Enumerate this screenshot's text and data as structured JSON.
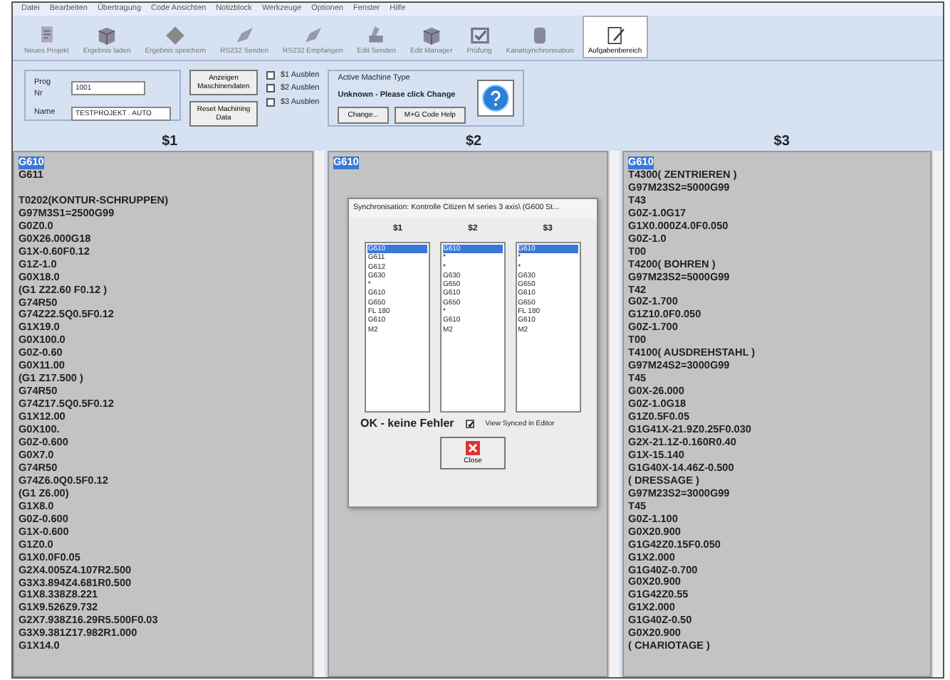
{
  "menu": [
    "Datei",
    "Bearbeiten",
    "Übertragung",
    "Code Ansichten",
    "Notizblock",
    "Werkzeuge",
    "Optionen",
    "Fenster",
    "Hilfe"
  ],
  "toolbar": [
    {
      "label": "Neues Projekt",
      "kind": "doc",
      "selected": false
    },
    {
      "label": "Ergebnis laden",
      "kind": "box",
      "selected": false
    },
    {
      "label": "Ergebnis speichern",
      "kind": "diamond",
      "selected": false
    },
    {
      "label": "RS232 Senden",
      "kind": "pen",
      "selected": false
    },
    {
      "label": "RS232 Empfangen",
      "kind": "pen",
      "selected": false
    },
    {
      "label": "Edit Senden",
      "kind": "machine",
      "selected": false
    },
    {
      "label": "Edit Manager",
      "kind": "box",
      "selected": false
    },
    {
      "label": "Prüfung",
      "kind": "check",
      "selected": false
    },
    {
      "label": "Kanalsynchronisation",
      "kind": "cylinder",
      "selected": false
    },
    {
      "label": "Aufgabenbereich",
      "kind": "note",
      "selected": true
    }
  ],
  "program_panel": {
    "prog_label": "Prog Nr",
    "prog_value": "1001",
    "name_label": "Name",
    "name_value": "TESTPROJEKT . AUTO",
    "buttons": [
      "Anzeigen Maschinendaten",
      "Reset Machining Data"
    ],
    "hide_checkboxes": [
      {
        "label": "$1 Ausblen",
        "checked": false
      },
      {
        "label": "$2 Ausblen",
        "checked": false
      },
      {
        "label": "$3 Ausblen",
        "checked": false
      }
    ]
  },
  "machine_type": {
    "legend": "Active Machine Type",
    "value": "Unknown - Please click Change",
    "buttons": [
      "Change...",
      "M+G Code Help"
    ]
  },
  "channels": [
    {
      "header": "$1",
      "lines": [
        {
          "text": "G610",
          "selected": true
        },
        {
          "text": "G611",
          "selected": false
        },
        {
          "text": "T0202(KONTUR-SCHRUPPEN)",
          "selected": false,
          "gap_before": true
        },
        {
          "text": "G97M3S1=2500G99",
          "selected": false
        },
        {
          "text": "G0Z0.0",
          "selected": false
        },
        {
          "text": "G0X26.000G18",
          "selected": false
        },
        {
          "text": "G1X-0.60F0.12",
          "selected": false
        },
        {
          "text": "G1Z-1.0",
          "selected": false
        },
        {
          "text": "G0X18.0",
          "selected": false
        },
        {
          "text": "(G1 Z22.60 F0.12 )",
          "selected": false
        },
        {
          "text": "G74R50",
          "selected": false
        },
        {
          "text": "G74Z22.5Q0.5F0.12",
          "selected": false
        },
        {
          "text": "G1X19.0",
          "selected": false
        },
        {
          "text": "G0X100.0",
          "selected": false
        },
        {
          "text": "G0Z-0.60",
          "selected": false
        },
        {
          "text": "G0X11.00",
          "selected": false
        },
        {
          "text": "(G1 Z17.500 )",
          "selected": false
        },
        {
          "text": "G74R50",
          "selected": false
        },
        {
          "text": "G74Z17.5Q0.5F0.12",
          "selected": false
        },
        {
          "text": "G1X12.00",
          "selected": false
        },
        {
          "text": "G0X100.",
          "selected": false
        },
        {
          "text": "G0Z-0.600",
          "selected": false
        },
        {
          "text": "G0X7.0",
          "selected": false
        },
        {
          "text": "G74R50",
          "selected": false
        },
        {
          "text": "G74Z6.0Q0.5F0.12",
          "selected": false
        },
        {
          "text": "(G1 Z6.00)",
          "selected": false
        },
        {
          "text": "G1X8.0",
          "selected": false
        },
        {
          "text": "G0Z-0.600",
          "selected": false
        },
        {
          "text": "G1X-0.600",
          "selected": false
        },
        {
          "text": "G1Z0.0",
          "selected": false
        },
        {
          "text": "G1X0.0F0.05",
          "selected": false
        },
        {
          "text": "G2X4.005Z4.107R2.500",
          "selected": false
        },
        {
          "text": "G3X3.894Z4.681R0.500",
          "selected": false
        },
        {
          "text": "G1X8.338Z8.221",
          "selected": false
        },
        {
          "text": "G1X9.526Z9.732",
          "selected": false
        },
        {
          "text": "G2X7.938Z16.29R5.500F0.03",
          "selected": false
        },
        {
          "text": "G3X9.381Z17.982R1.000",
          "selected": false
        },
        {
          "text": "G1X14.0",
          "selected": false
        }
      ]
    },
    {
      "header": "$2",
      "lines": [
        {
          "text": "G610",
          "selected": true
        }
      ]
    },
    {
      "header": "$3",
      "lines": [
        {
          "text": "G610",
          "selected": true
        },
        {
          "text": "T4300( ZENTRIEREN )",
          "selected": false
        },
        {
          "text": "G97M23S2=5000G99",
          "selected": false
        },
        {
          "text": "T43",
          "selected": false
        },
        {
          "text": "G0Z-1.0G17",
          "selected": false
        },
        {
          "text": "G1X0.000Z4.0F0.050",
          "selected": false
        },
        {
          "text": "G0Z-1.0",
          "selected": false
        },
        {
          "text": "T00",
          "selected": false
        },
        {
          "text": "T4200( BOHREN )",
          "selected": false
        },
        {
          "text": "G97M23S2=5000G99",
          "selected": false
        },
        {
          "text": "T42",
          "selected": false
        },
        {
          "text": "G0Z-1.700",
          "selected": false
        },
        {
          "text": "G1Z10.0F0.050",
          "selected": false
        },
        {
          "text": "G0Z-1.700",
          "selected": false
        },
        {
          "text": "T00",
          "selected": false
        },
        {
          "text": "T4100( AUSDREHSTAHL )",
          "selected": false
        },
        {
          "text": "G97M24S2=3000G99",
          "selected": false
        },
        {
          "text": "T45",
          "selected": false
        },
        {
          "text": "G0X-26.000",
          "selected": false
        },
        {
          "text": "G0Z-1.0G18",
          "selected": false
        },
        {
          "text": "G1Z0.5F0.05",
          "selected": false
        },
        {
          "text": "G1G41X-21.9Z0.25F0.030",
          "selected": false
        },
        {
          "text": "G2X-21.1Z-0.160R0.40",
          "selected": false
        },
        {
          "text": "G1X-15.140",
          "selected": false
        },
        {
          "text": "G1G40X-14.46Z-0.500",
          "selected": false
        },
        {
          "text": "( DRESSAGE )",
          "selected": false
        },
        {
          "text": "G97M23S2=3000G99",
          "selected": false
        },
        {
          "text": "T45",
          "selected": false
        },
        {
          "text": "G0Z-1.100",
          "selected": false
        },
        {
          "text": "G0X20.900",
          "selected": false
        },
        {
          "text": "G1G42Z0.15F0.050",
          "selected": false
        },
        {
          "text": "G1X2.000",
          "selected": false
        },
        {
          "text": "G1G40Z-0.700",
          "selected": false
        },
        {
          "text": "G0X20.900",
          "selected": false
        },
        {
          "text": "G1G42Z0.55",
          "selected": false
        },
        {
          "text": "G1X2.000",
          "selected": false
        },
        {
          "text": "G1G40Z-0.50",
          "selected": false
        },
        {
          "text": "G0X20.900",
          "selected": false
        },
        {
          "text": "( CHARIOTAGE )",
          "selected": false
        }
      ]
    }
  ],
  "dialog": {
    "title": "Synchronisation: Kontrolle Citizen M series 3 axis\\ (G600 St...",
    "lists": [
      {
        "header": "$1",
        "items": [
          {
            "text": "G610",
            "selected": true
          },
          {
            "text": "G611",
            "selected": false
          },
          {
            "text": "G612",
            "selected": false
          },
          {
            "text": "G630",
            "selected": false
          },
          {
            "text": "*",
            "selected": false
          },
          {
            "text": "G610",
            "selected": false
          },
          {
            "text": "G650",
            "selected": false
          },
          {
            "text": "FL 180",
            "selected": false
          },
          {
            "text": "G610",
            "selected": false
          },
          {
            "text": "M2",
            "selected": false
          }
        ]
      },
      {
        "header": "$2",
        "items": [
          {
            "text": "G610",
            "selected": true
          },
          {
            "text": "*",
            "selected": false
          },
          {
            "text": "*",
            "selected": false
          },
          {
            "text": "G630",
            "selected": false
          },
          {
            "text": "G650",
            "selected": false
          },
          {
            "text": "G610",
            "selected": false
          },
          {
            "text": "G650",
            "selected": false
          },
          {
            "text": "*",
            "selected": false
          },
          {
            "text": "G610",
            "selected": false
          },
          {
            "text": "M2",
            "selected": false
          }
        ]
      },
      {
        "header": "$3",
        "items": [
          {
            "text": "G610",
            "selected": true
          },
          {
            "text": "*",
            "selected": false
          },
          {
            "text": "*",
            "selected": false
          },
          {
            "text": "G630",
            "selected": false
          },
          {
            "text": "G650",
            "selected": false
          },
          {
            "text": "G610",
            "selected": false
          },
          {
            "text": "G650",
            "selected": false
          },
          {
            "text": "FL 180",
            "selected": false
          },
          {
            "text": "G610",
            "selected": false
          },
          {
            "text": "M2",
            "selected": false
          }
        ]
      }
    ],
    "status": "OK - keine Fehler",
    "view_synced": {
      "label": "View Synced in Editor",
      "checked": true
    },
    "close_button": "Close"
  }
}
